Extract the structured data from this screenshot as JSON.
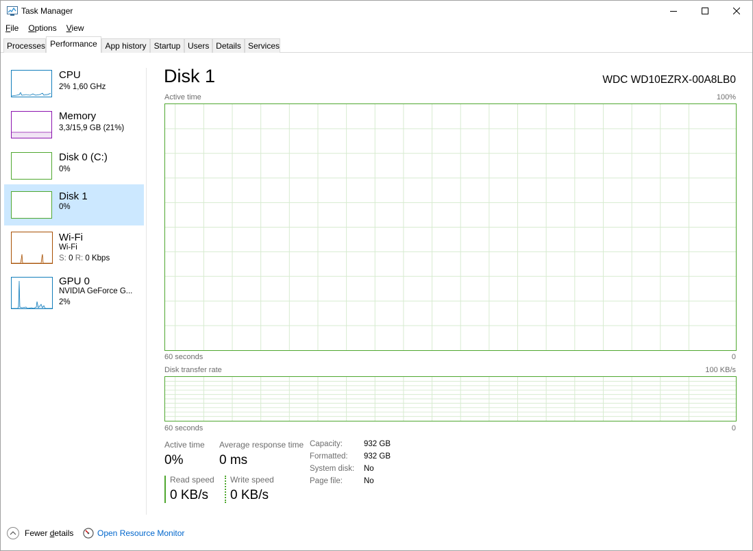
{
  "window": {
    "title": "Task Manager"
  },
  "menu": [
    {
      "pre": "",
      "u": "F",
      "post": "ile"
    },
    {
      "pre": "",
      "u": "O",
      "post": "ptions"
    },
    {
      "pre": "",
      "u": "V",
      "post": "iew"
    }
  ],
  "tabs": [
    "Processes",
    "Performance",
    "App history",
    "Startup",
    "Users",
    "Details",
    "Services"
  ],
  "sidebar": {
    "items": [
      {
        "name": "CPU",
        "line1": "2%  1,60 GHz",
        "color": "#117dbb"
      },
      {
        "name": "Memory",
        "line1": "3,3/15,9 GB (21%)",
        "color": "#8b12ae"
      },
      {
        "name": "Disk 0 (C:)",
        "line1": "0%",
        "color": "#4ea72e"
      },
      {
        "name": "Disk 1",
        "line1": "0%",
        "color": "#4ea72e"
      },
      {
        "name": "Wi-Fi",
        "line1": "Wi-Fi",
        "line2_s": "S:",
        "line2_sv": "0",
        "line2_r": "R:",
        "line2_rv": "0 Kbps",
        "color": "#a74f01"
      },
      {
        "name": "GPU 0",
        "line1": "NVIDIA GeForce G...",
        "line2": "2%",
        "color": "#117dbb"
      }
    ]
  },
  "main": {
    "title": "Disk 1",
    "device": "WDC WD10EZRX-00A8LB0",
    "graph1": {
      "label": "Active time",
      "max": "100%",
      "x_left": "60 seconds",
      "x_right": "0"
    },
    "graph2": {
      "label": "Disk transfer rate",
      "max": "100 KB/s",
      "x_left": "60 seconds",
      "x_right": "0"
    },
    "stats": {
      "active_time_label": "Active time",
      "active_time_value": "0%",
      "avg_resp_label": "Average response time",
      "avg_resp_value": "0 ms",
      "read_label": "Read speed",
      "read_value": "0 KB/s",
      "write_label": "Write speed",
      "write_value": "0 KB/s"
    },
    "details": [
      {
        "k": "Capacity:",
        "v": "932 GB"
      },
      {
        "k": "Formatted:",
        "v": "932 GB"
      },
      {
        "k": "System disk:",
        "v": "No"
      },
      {
        "k": "Page file:",
        "v": "No"
      }
    ]
  },
  "footer": {
    "fewer_pre": "Fewer ",
    "fewer_u": "d",
    "fewer_post": "etails",
    "resource_monitor": "Open Resource Monitor"
  },
  "colors": {
    "disk": "#4ea72e",
    "selected": "#cce8ff",
    "link": "#0066cc"
  }
}
